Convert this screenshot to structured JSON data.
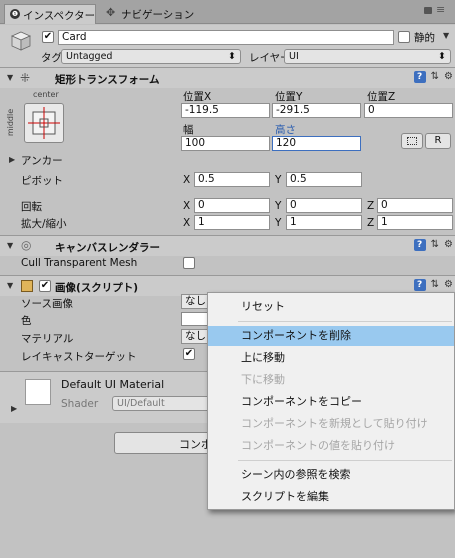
{
  "tabs": [
    {
      "label": "インスペクター",
      "icon": "info-icon"
    },
    {
      "label": "ナビゲーション",
      "icon": "navigation-icon"
    }
  ],
  "object": {
    "name": "Card",
    "static_label": "静的",
    "tag_label": "タグ",
    "tag_value": "Untagged",
    "layer_label": "レイヤー",
    "layer_value": "UI"
  },
  "rect_transform": {
    "title": "矩形トランスフォーム",
    "anchor_preset_top": "center",
    "anchor_preset_side": "middle",
    "headers": [
      "位置X",
      "位置Y",
      "位置Z"
    ],
    "values": [
      "-119.5",
      "-291.5",
      "0"
    ],
    "width_label": "幅",
    "height_label": "高さ",
    "width": "100",
    "height": "120",
    "r_button": "R",
    "anchor_label": "アンカー",
    "pivot_label": "ピボット",
    "pivot": {
      "x": "0.5",
      "y": "0.5"
    },
    "rotation_label": "回転",
    "rotation": {
      "x": "0",
      "y": "0",
      "z": "0"
    },
    "scale_label": "拡大/縮小",
    "scale": {
      "x": "1",
      "y": "1",
      "z": "1"
    },
    "axis_x": "X",
    "axis_y": "Y",
    "axis_z": "Z"
  },
  "canvas_renderer": {
    "title": "キャンバスレンダラー",
    "cull_label": "Cull Transparent Mesh"
  },
  "image": {
    "title": "画像(スクリプト)",
    "source_label": "ソース画像",
    "source_value": "なし",
    "color_label": "色",
    "material_label": "マテリアル",
    "material_value": "なし",
    "raycast_label": "レイキャストターゲット"
  },
  "material": {
    "name": "Default UI Material",
    "shader_label": "Shader",
    "shader_value": "UI/Default"
  },
  "add_component_label": "コンポ",
  "context_menu": {
    "items": [
      {
        "label": "リセット",
        "state": "normal"
      },
      {
        "label": "コンポーネントを削除",
        "state": "highlighted"
      },
      {
        "label": "上に移動",
        "state": "normal"
      },
      {
        "label": "下に移動",
        "state": "disabled"
      },
      {
        "label": "コンポーネントをコピー",
        "state": "normal"
      },
      {
        "label": "コンポーネントを新規として貼り付け",
        "state": "disabled"
      },
      {
        "label": "コンポーネントの値を貼り付け",
        "state": "disabled"
      },
      {
        "label": "シーン内の参照を検索",
        "state": "normal"
      },
      {
        "label": "スクリプトを編集",
        "state": "normal"
      }
    ]
  },
  "colors": {
    "accent_blue": "#3d6fbf",
    "highlight": "#99c9ef",
    "panel_bg": "#c2c2c2"
  }
}
